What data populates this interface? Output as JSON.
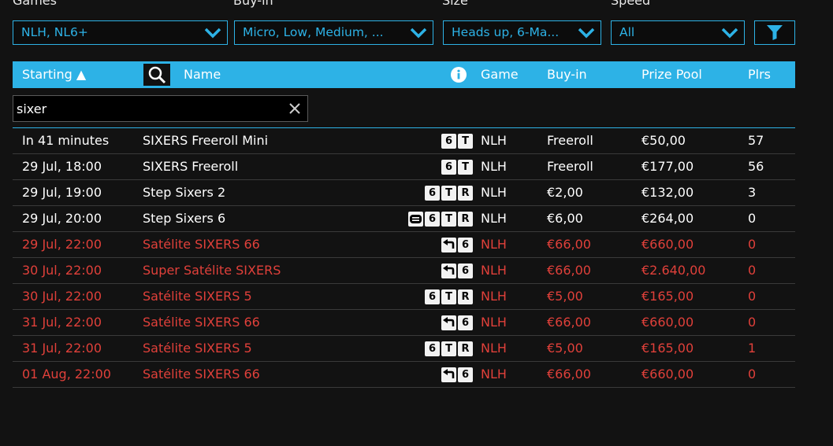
{
  "filters": {
    "games": {
      "label": "Games",
      "value": "NLH, NL6+"
    },
    "buyin": {
      "label": "Buy-in",
      "value": "Micro, Low, Medium, ..."
    },
    "size": {
      "label": "Size",
      "value": "Heads up, 6-Ma..."
    },
    "speed": {
      "label": "Speed",
      "value": "All"
    },
    "filter_icon": "funnel-icon"
  },
  "columns": {
    "starting": "Starting ▲",
    "name": "Name",
    "game": "Game",
    "buyin": "Buy-in",
    "prize_pool": "Prize Pool",
    "players": "Plrs"
  },
  "search": {
    "value": "sixer",
    "clear_icon": "close-icon"
  },
  "colors": {
    "accent": "#2db2e6",
    "satellite": "#e0403a",
    "background": "#121212"
  },
  "rows": [
    {
      "starting": "In 41 minutes",
      "name": "SIXERS Freeroll Mini",
      "tags": [
        "6",
        "T"
      ],
      "game": "NLH",
      "buyin": "Freeroll",
      "prize": "€50,00",
      "players": "57",
      "satellite": false
    },
    {
      "starting": "29 Jul, 18:00",
      "name": "SIXERS Freeroll",
      "tags": [
        "6",
        "T"
      ],
      "game": "NLH",
      "buyin": "Freeroll",
      "prize": "€177,00",
      "players": "56",
      "satellite": false
    },
    {
      "starting": "29 Jul, 19:00",
      "name": "Step Sixers 2",
      "tags": [
        "6",
        "T",
        "R"
      ],
      "game": "NLH",
      "buyin": "€2,00",
      "prize": "€132,00",
      "players": "3",
      "satellite": false
    },
    {
      "starting": "29 Jul, 20:00",
      "name": "Step Sixers 6",
      "tags": [
        "ticket",
        "6",
        "T",
        "R"
      ],
      "game": "NLH",
      "buyin": "€6,00",
      "prize": "€264,00",
      "players": "0",
      "satellite": false
    },
    {
      "starting": "29 Jul, 22:00",
      "name": "Satélite SIXERS 66",
      "tags": [
        "rebuy",
        "6"
      ],
      "game": "NLH",
      "buyin": "€66,00",
      "prize": "€660,00",
      "players": "0",
      "satellite": true
    },
    {
      "starting": "30 Jul, 22:00",
      "name": "Super Satélite SIXERS",
      "tags": [
        "rebuy",
        "6"
      ],
      "game": "NLH",
      "buyin": "€66,00",
      "prize": "€2.640,00",
      "players": "0",
      "satellite": true
    },
    {
      "starting": "30 Jul, 22:00",
      "name": "Satélite SIXERS 5",
      "tags": [
        "6",
        "T",
        "R"
      ],
      "game": "NLH",
      "buyin": "€5,00",
      "prize": "€165,00",
      "players": "0",
      "satellite": true
    },
    {
      "starting": "31 Jul, 22:00",
      "name": "Satélite SIXERS 66",
      "tags": [
        "rebuy",
        "6"
      ],
      "game": "NLH",
      "buyin": "€66,00",
      "prize": "€660,00",
      "players": "0",
      "satellite": true
    },
    {
      "starting": "31 Jul, 22:00",
      "name": "Satélite SIXERS 5",
      "tags": [
        "6",
        "T",
        "R"
      ],
      "game": "NLH",
      "buyin": "€5,00",
      "prize": "€165,00",
      "players": "1",
      "satellite": true
    },
    {
      "starting": "01 Aug, 22:00",
      "name": "Satélite SIXERS 66",
      "tags": [
        "rebuy",
        "6"
      ],
      "game": "NLH",
      "buyin": "€66,00",
      "prize": "€660,00",
      "players": "0",
      "satellite": true
    }
  ]
}
